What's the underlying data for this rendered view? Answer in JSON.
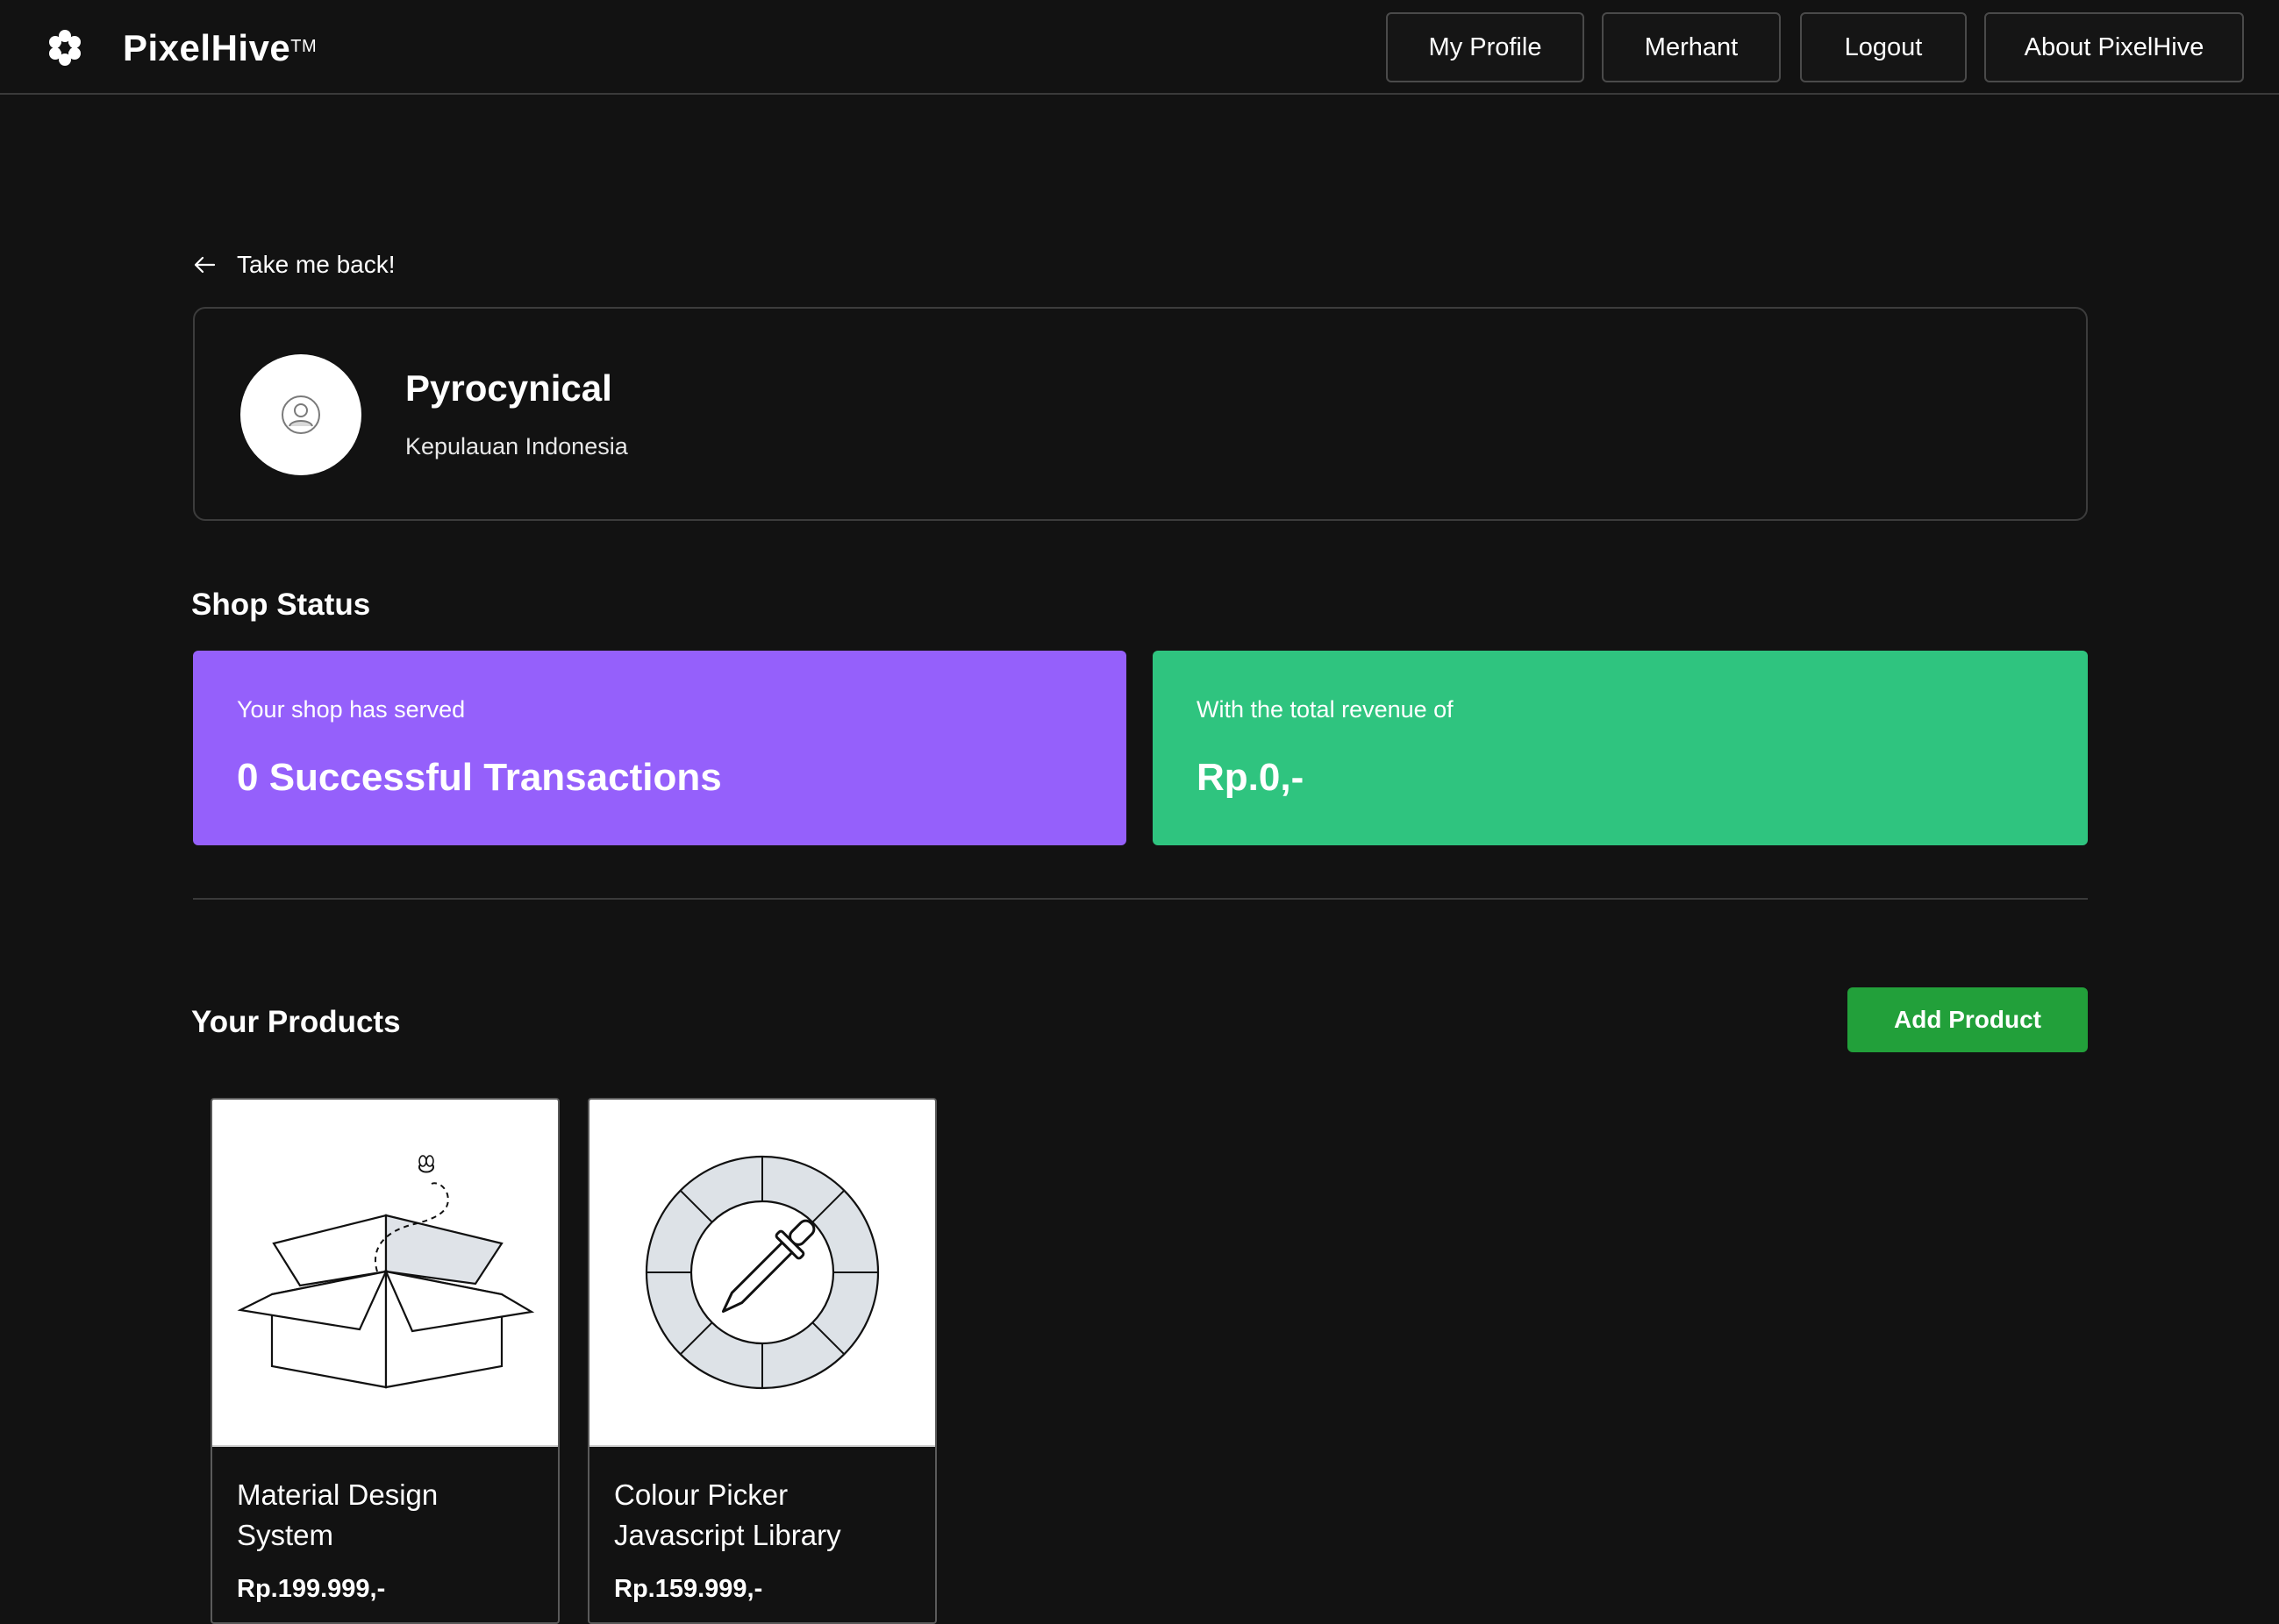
{
  "brand": {
    "name": "PixelHive",
    "trademark": "TM",
    "logo_icon": "hexagon-cluster-icon"
  },
  "nav": {
    "items": [
      {
        "label": "My Profile"
      },
      {
        "label": "Merhant"
      },
      {
        "label": "Logout"
      },
      {
        "label": "About PixelHive"
      }
    ]
  },
  "back": {
    "label": "Take me back!",
    "icon": "arrow-left-icon"
  },
  "profile": {
    "name": "Pyrocynical",
    "location": "Kepulauan Indonesia",
    "avatar_icon": "user-avatar-icon"
  },
  "shop_status": {
    "title": "Shop Status",
    "transactions": {
      "label": "Your shop has served",
      "value": "0 Successful Transactions",
      "color": "#9560fb"
    },
    "revenue": {
      "label": "With the total revenue of",
      "value": "Rp.0,-",
      "color": "#2fc47f"
    }
  },
  "products": {
    "title": "Your Products",
    "add_label": "Add Product",
    "add_color": "#22a03a",
    "items": [
      {
        "title": "Material Design System",
        "price": "Rp.199.999,-",
        "image_icon": "open-box-icon"
      },
      {
        "title": "Colour Picker Javascript Library",
        "price": "Rp.159.999,-",
        "image_icon": "color-picker-icon"
      }
    ]
  }
}
